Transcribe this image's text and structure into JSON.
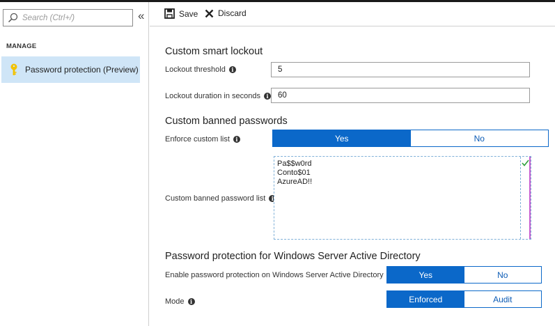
{
  "sidebar": {
    "search_placeholder": "Search (Ctrl+/)",
    "collapse_glyph": "«",
    "section_label": "MANAGE",
    "items": [
      {
        "label": "Password protection (Preview)",
        "icon": "key-icon",
        "selected": true
      }
    ]
  },
  "toolbar": {
    "save_label": "Save",
    "discard_label": "Discard"
  },
  "smart_lockout": {
    "heading": "Custom smart lockout",
    "threshold_label": "Lockout threshold",
    "threshold_value": "5",
    "duration_label": "Lockout duration in seconds",
    "duration_value": "60"
  },
  "banned_passwords": {
    "heading": "Custom banned passwords",
    "enforce_label": "Enforce custom list",
    "enforce_options": [
      "Yes",
      "No"
    ],
    "enforce_selected": "Yes",
    "list_label": "Custom banned password list",
    "list_value": "Pa$$w0rd\nConto$01\nAzureAD!!"
  },
  "windows_ad": {
    "heading": "Password protection for Windows Server Active Directory",
    "enable_label": "Enable password protection on Windows Server Active Directory",
    "enable_options": [
      "Yes",
      "No"
    ],
    "enable_selected": "Yes",
    "mode_label": "Mode",
    "mode_options": [
      "Enforced",
      "Audit"
    ],
    "mode_selected": "Enforced"
  },
  "colors": {
    "accent": "#0b68c9",
    "sidebar_selected": "#cfe5f7",
    "key_icon": "#f2c200"
  }
}
